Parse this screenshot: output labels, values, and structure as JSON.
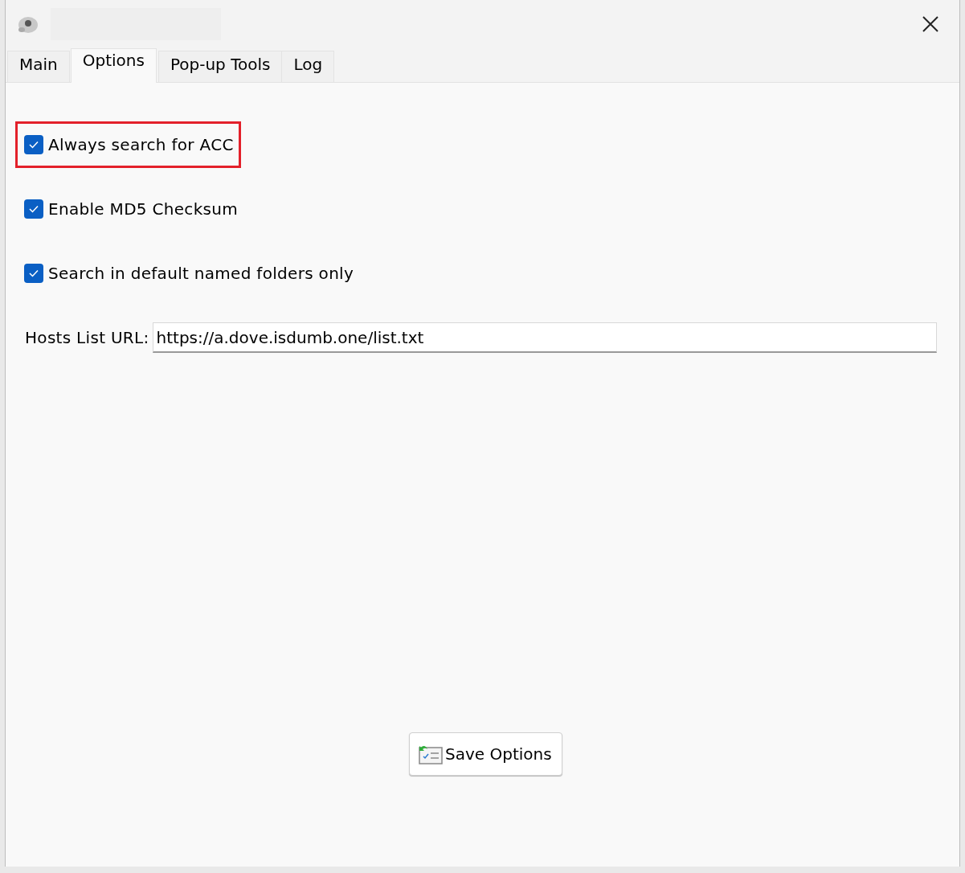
{
  "tabs": [
    {
      "label": "Main",
      "selected": false
    },
    {
      "label": "Options",
      "selected": true
    },
    {
      "label": "Pop-up Tools",
      "selected": false
    },
    {
      "label": "Log",
      "selected": false
    }
  ],
  "options": [
    {
      "label": "Always search for ACC",
      "checked": true,
      "highlighted": true
    },
    {
      "label": "Enable MD5 Checksum",
      "checked": true,
      "highlighted": false
    },
    {
      "label": "Search in default named folders only",
      "checked": true,
      "highlighted": false
    }
  ],
  "hosts_list_url": {
    "label": "Hosts List URL:",
    "value": "https://a.dove.isdumb.one/list.txt"
  },
  "save_button": "Save Options"
}
